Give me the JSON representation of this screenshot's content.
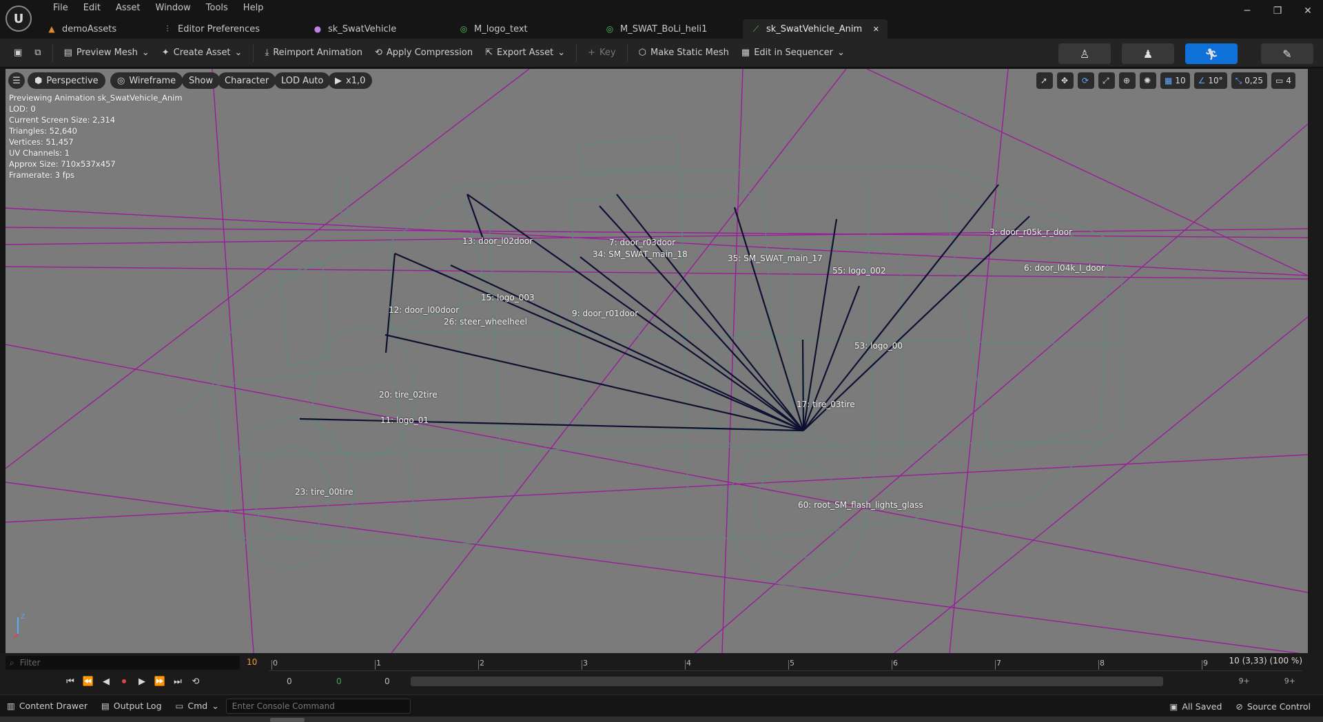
{
  "app": {
    "logo_letter": "U",
    "menu": [
      "File",
      "Edit",
      "Asset",
      "Window",
      "Tools",
      "Help"
    ],
    "tabs": [
      {
        "label": "demoAssets",
        "icon": "folder-icon",
        "color": "#e08a2a"
      },
      {
        "label": "Editor Preferences",
        "icon": "sliders-icon",
        "color": "#c8c8c8"
      },
      {
        "label": "sk_SwatVehicle",
        "icon": "skeleton-icon",
        "color": "#c080e0"
      },
      {
        "label": "M_logo_text",
        "icon": "material-icon",
        "color": "#5ac05a"
      },
      {
        "label": "M_SWAT_BoLi_heli1",
        "icon": "material-icon",
        "color": "#5ac05a"
      },
      {
        "label": "sk_SwatVehicle_Anim",
        "icon": "anim-icon",
        "color": "#5ac05a",
        "active": true
      }
    ],
    "tab_close": "✕"
  },
  "toolbar": {
    "preview_mesh": "Preview Mesh",
    "create_asset": "Create Asset",
    "reimport": "Reimport Animation",
    "apply_compression": "Apply Compression",
    "export_asset": "Export Asset",
    "key": "Key",
    "make_static_mesh": "Make Static Mesh",
    "edit_in_sequencer": "Edit in Sequencer"
  },
  "viewport": {
    "pills": {
      "menu": "☰",
      "perspective": "Perspective",
      "wireframe": "Wireframe",
      "show": "Show",
      "character": "Character",
      "lod": "LOD Auto",
      "speed": "x1,0"
    },
    "right_tools": {
      "grid_snap": "10",
      "rot_snap": "10°",
      "scale_snap": "0,25",
      "cam_speed": "4"
    },
    "stats": [
      "Previewing Animation sk_SwatVehicle_Anim",
      "LOD: 0",
      "Current Screen Size: 2,314",
      "Triangles: 52,640",
      "Vertices: 51,457",
      "UV Channels: 1",
      "Approx Size: 710x537x457",
      "Framerate: 3 fps"
    ],
    "bones": [
      "13: door_l02door",
      "7: door_r03door",
      "34: SM_SWAT_main_18",
      "35: SM_SWAT_main_17",
      "3: door_r05k_r_door",
      "55: logo_002",
      "6: door_l04k_l_door",
      "15: logo_003",
      "12: door_l00door",
      "26: steer_wheelheel",
      "9: door_r01door",
      "53: logo_00",
      "20: tire_02tire",
      "17: tire_03tire",
      "11: logo_01",
      "23: tire_00tire",
      "60: root_SM_flash_lights_glass"
    ],
    "colors": {
      "background": "#7b7b7b",
      "mesh": "#5f8a7a",
      "bone_line": "#0d1030",
      "guide": "#a020a0"
    }
  },
  "timeline": {
    "filter_placeholder": "Filter",
    "frame_count": "10",
    "ticks": [
      "0",
      "1",
      "2",
      "3",
      "4",
      "5",
      "6",
      "7",
      "8",
      "9"
    ],
    "playhead": "10 (3,33) (100 %)",
    "start_val": "0",
    "mid_val": "0",
    "end_val": "0",
    "right_a": "9+",
    "right_b": "9+"
  },
  "statusbar": {
    "content_drawer": "Content Drawer",
    "output_log": "Output Log",
    "cmd": "Cmd",
    "console_placeholder": "Enter Console Command",
    "all_saved": "All Saved",
    "source_control": "Source Control"
  }
}
